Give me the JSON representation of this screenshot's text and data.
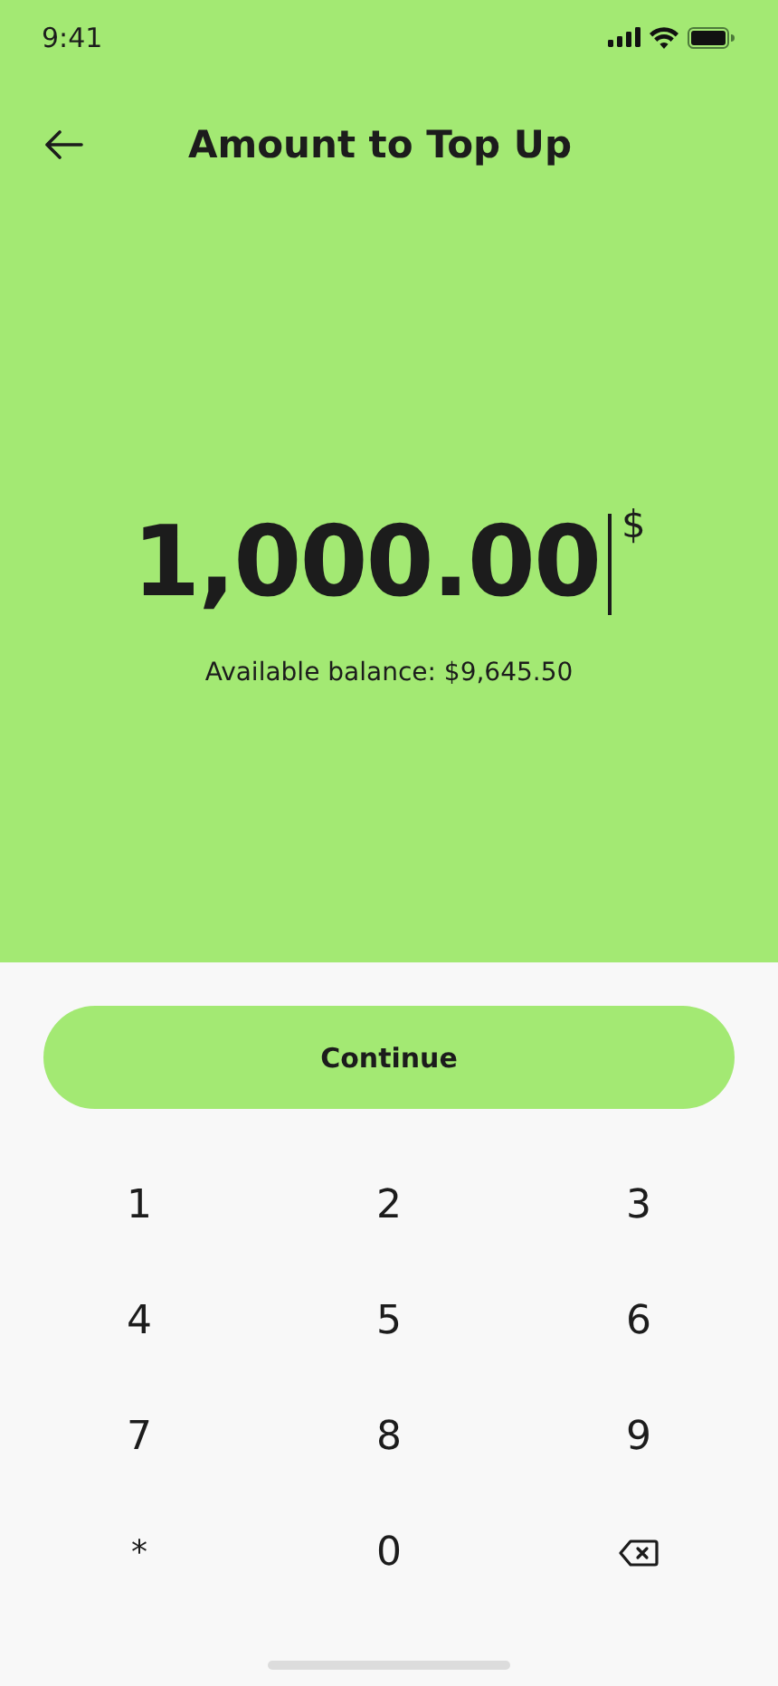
{
  "status_bar": {
    "time": "9:41"
  },
  "header": {
    "title": "Amount to Top Up"
  },
  "amount": {
    "value": "1,000.00",
    "currency": "$",
    "caret": true,
    "balance": "Available balance: $9,645.50"
  },
  "continue_button": {
    "label": "Continue"
  },
  "keypad": [
    {
      "kind": "digit",
      "label": "1"
    },
    {
      "kind": "digit",
      "label": "2"
    },
    {
      "kind": "digit",
      "label": "3"
    },
    {
      "kind": "digit",
      "label": "4"
    },
    {
      "kind": "digit",
      "label": "5"
    },
    {
      "kind": "digit",
      "label": "6"
    },
    {
      "kind": "digit",
      "label": "7"
    },
    {
      "kind": "digit",
      "label": "8"
    },
    {
      "kind": "digit",
      "label": "9"
    },
    {
      "kind": "symbol",
      "label": "*"
    },
    {
      "kind": "digit",
      "label": "0"
    },
    {
      "kind": "backspace"
    }
  ]
}
